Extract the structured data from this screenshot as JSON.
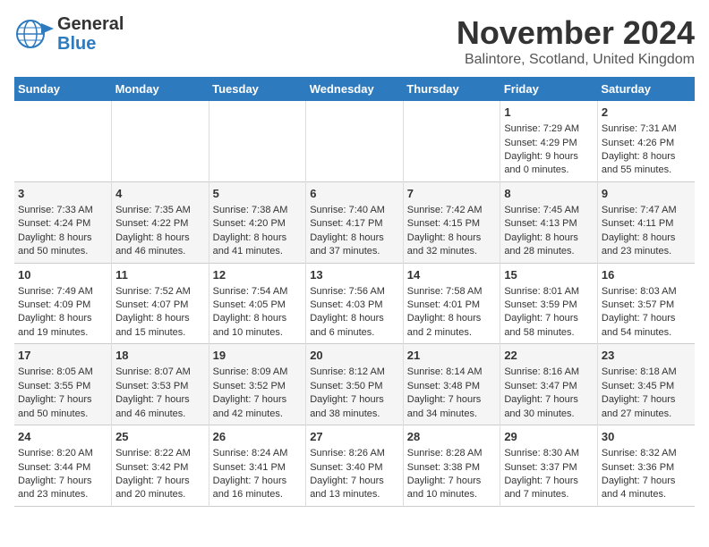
{
  "logo": {
    "line1": "General",
    "line2": "Blue"
  },
  "title": "November 2024",
  "subtitle": "Balintore, Scotland, United Kingdom",
  "days_of_week": [
    "Sunday",
    "Monday",
    "Tuesday",
    "Wednesday",
    "Thursday",
    "Friday",
    "Saturday"
  ],
  "weeks": [
    [
      {
        "day": "",
        "sunrise": "",
        "sunset": "",
        "daylight": ""
      },
      {
        "day": "",
        "sunrise": "",
        "sunset": "",
        "daylight": ""
      },
      {
        "day": "",
        "sunrise": "",
        "sunset": "",
        "daylight": ""
      },
      {
        "day": "",
        "sunrise": "",
        "sunset": "",
        "daylight": ""
      },
      {
        "day": "",
        "sunrise": "",
        "sunset": "",
        "daylight": ""
      },
      {
        "day": "1",
        "sunrise": "Sunrise: 7:29 AM",
        "sunset": "Sunset: 4:29 PM",
        "daylight": "Daylight: 9 hours and 0 minutes."
      },
      {
        "day": "2",
        "sunrise": "Sunrise: 7:31 AM",
        "sunset": "Sunset: 4:26 PM",
        "daylight": "Daylight: 8 hours and 55 minutes."
      }
    ],
    [
      {
        "day": "3",
        "sunrise": "Sunrise: 7:33 AM",
        "sunset": "Sunset: 4:24 PM",
        "daylight": "Daylight: 8 hours and 50 minutes."
      },
      {
        "day": "4",
        "sunrise": "Sunrise: 7:35 AM",
        "sunset": "Sunset: 4:22 PM",
        "daylight": "Daylight: 8 hours and 46 minutes."
      },
      {
        "day": "5",
        "sunrise": "Sunrise: 7:38 AM",
        "sunset": "Sunset: 4:20 PM",
        "daylight": "Daylight: 8 hours and 41 minutes."
      },
      {
        "day": "6",
        "sunrise": "Sunrise: 7:40 AM",
        "sunset": "Sunset: 4:17 PM",
        "daylight": "Daylight: 8 hours and 37 minutes."
      },
      {
        "day": "7",
        "sunrise": "Sunrise: 7:42 AM",
        "sunset": "Sunset: 4:15 PM",
        "daylight": "Daylight: 8 hours and 32 minutes."
      },
      {
        "day": "8",
        "sunrise": "Sunrise: 7:45 AM",
        "sunset": "Sunset: 4:13 PM",
        "daylight": "Daylight: 8 hours and 28 minutes."
      },
      {
        "day": "9",
        "sunrise": "Sunrise: 7:47 AM",
        "sunset": "Sunset: 4:11 PM",
        "daylight": "Daylight: 8 hours and 23 minutes."
      }
    ],
    [
      {
        "day": "10",
        "sunrise": "Sunrise: 7:49 AM",
        "sunset": "Sunset: 4:09 PM",
        "daylight": "Daylight: 8 hours and 19 minutes."
      },
      {
        "day": "11",
        "sunrise": "Sunrise: 7:52 AM",
        "sunset": "Sunset: 4:07 PM",
        "daylight": "Daylight: 8 hours and 15 minutes."
      },
      {
        "day": "12",
        "sunrise": "Sunrise: 7:54 AM",
        "sunset": "Sunset: 4:05 PM",
        "daylight": "Daylight: 8 hours and 10 minutes."
      },
      {
        "day": "13",
        "sunrise": "Sunrise: 7:56 AM",
        "sunset": "Sunset: 4:03 PM",
        "daylight": "Daylight: 8 hours and 6 minutes."
      },
      {
        "day": "14",
        "sunrise": "Sunrise: 7:58 AM",
        "sunset": "Sunset: 4:01 PM",
        "daylight": "Daylight: 8 hours and 2 minutes."
      },
      {
        "day": "15",
        "sunrise": "Sunrise: 8:01 AM",
        "sunset": "Sunset: 3:59 PM",
        "daylight": "Daylight: 7 hours and 58 minutes."
      },
      {
        "day": "16",
        "sunrise": "Sunrise: 8:03 AM",
        "sunset": "Sunset: 3:57 PM",
        "daylight": "Daylight: 7 hours and 54 minutes."
      }
    ],
    [
      {
        "day": "17",
        "sunrise": "Sunrise: 8:05 AM",
        "sunset": "Sunset: 3:55 PM",
        "daylight": "Daylight: 7 hours and 50 minutes."
      },
      {
        "day": "18",
        "sunrise": "Sunrise: 8:07 AM",
        "sunset": "Sunset: 3:53 PM",
        "daylight": "Daylight: 7 hours and 46 minutes."
      },
      {
        "day": "19",
        "sunrise": "Sunrise: 8:09 AM",
        "sunset": "Sunset: 3:52 PM",
        "daylight": "Daylight: 7 hours and 42 minutes."
      },
      {
        "day": "20",
        "sunrise": "Sunrise: 8:12 AM",
        "sunset": "Sunset: 3:50 PM",
        "daylight": "Daylight: 7 hours and 38 minutes."
      },
      {
        "day": "21",
        "sunrise": "Sunrise: 8:14 AM",
        "sunset": "Sunset: 3:48 PM",
        "daylight": "Daylight: 7 hours and 34 minutes."
      },
      {
        "day": "22",
        "sunrise": "Sunrise: 8:16 AM",
        "sunset": "Sunset: 3:47 PM",
        "daylight": "Daylight: 7 hours and 30 minutes."
      },
      {
        "day": "23",
        "sunrise": "Sunrise: 8:18 AM",
        "sunset": "Sunset: 3:45 PM",
        "daylight": "Daylight: 7 hours and 27 minutes."
      }
    ],
    [
      {
        "day": "24",
        "sunrise": "Sunrise: 8:20 AM",
        "sunset": "Sunset: 3:44 PM",
        "daylight": "Daylight: 7 hours and 23 minutes."
      },
      {
        "day": "25",
        "sunrise": "Sunrise: 8:22 AM",
        "sunset": "Sunset: 3:42 PM",
        "daylight": "Daylight: 7 hours and 20 minutes."
      },
      {
        "day": "26",
        "sunrise": "Sunrise: 8:24 AM",
        "sunset": "Sunset: 3:41 PM",
        "daylight": "Daylight: 7 hours and 16 minutes."
      },
      {
        "day": "27",
        "sunrise": "Sunrise: 8:26 AM",
        "sunset": "Sunset: 3:40 PM",
        "daylight": "Daylight: 7 hours and 13 minutes."
      },
      {
        "day": "28",
        "sunrise": "Sunrise: 8:28 AM",
        "sunset": "Sunset: 3:38 PM",
        "daylight": "Daylight: 7 hours and 10 minutes."
      },
      {
        "day": "29",
        "sunrise": "Sunrise: 8:30 AM",
        "sunset": "Sunset: 3:37 PM",
        "daylight": "Daylight: 7 hours and 7 minutes."
      },
      {
        "day": "30",
        "sunrise": "Sunrise: 8:32 AM",
        "sunset": "Sunset: 3:36 PM",
        "daylight": "Daylight: 7 hours and 4 minutes."
      }
    ]
  ]
}
